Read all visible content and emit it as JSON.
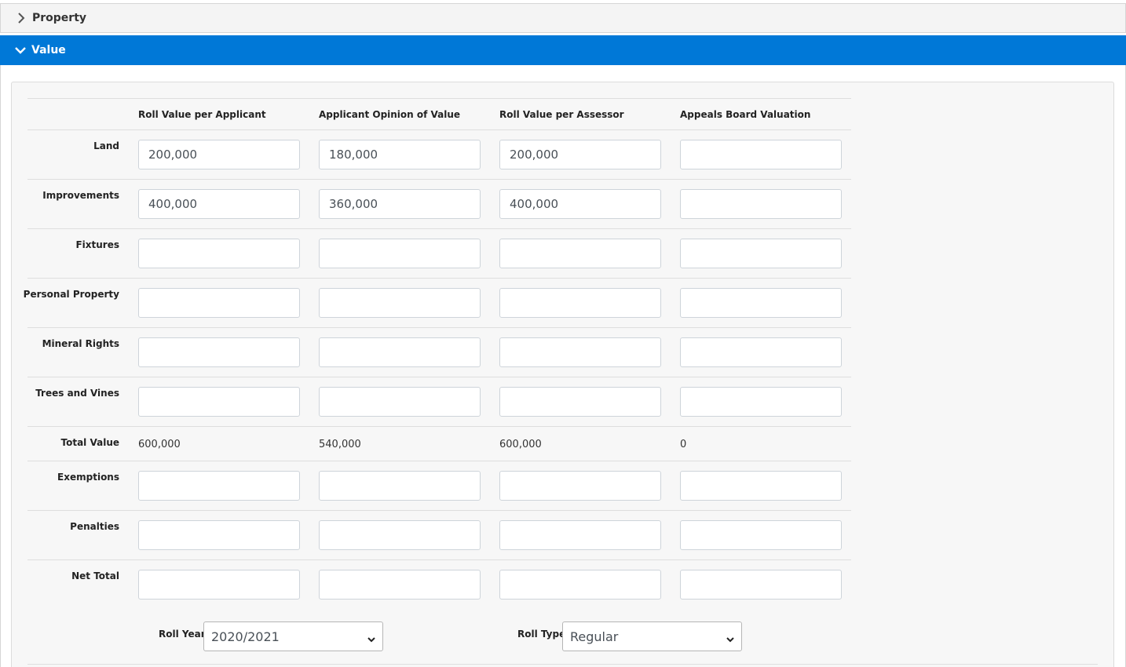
{
  "sections": {
    "property": {
      "title": "Property",
      "expanded": false
    },
    "value": {
      "title": "Value",
      "expanded": true
    }
  },
  "colors": {
    "accent": "#0078d7"
  },
  "table": {
    "columns": [
      "Roll Value per Applicant",
      "Applicant Opinion of Value",
      "Roll Value per Assessor",
      "Appeals Board Valuation"
    ],
    "rows": [
      {
        "label": "Land",
        "values": [
          "200,000",
          "180,000",
          "200,000",
          ""
        ]
      },
      {
        "label": "Improvements",
        "values": [
          "400,000",
          "360,000",
          "400,000",
          ""
        ]
      },
      {
        "label": "Fixtures",
        "values": [
          "",
          "",
          "",
          ""
        ]
      },
      {
        "label": "Personal Property",
        "values": [
          "",
          "",
          "",
          ""
        ]
      },
      {
        "label": "Mineral Rights",
        "values": [
          "",
          "",
          "",
          ""
        ]
      },
      {
        "label": "Trees and Vines",
        "values": [
          "",
          "",
          "",
          ""
        ]
      }
    ],
    "total": {
      "label": "Total Value",
      "values": [
        "600,000",
        "540,000",
        "600,000",
        "0"
      ]
    },
    "rows_after": [
      {
        "label": "Exemptions",
        "values": [
          "",
          "",
          "",
          ""
        ]
      },
      {
        "label": "Penalties",
        "values": [
          "",
          "",
          "",
          ""
        ]
      },
      {
        "label": "Net Total",
        "values": [
          "",
          "",
          "",
          ""
        ]
      }
    ]
  },
  "roll_year": {
    "label": "Roll Year",
    "value": "2020/2021"
  },
  "roll_type": {
    "label": "Roll Type",
    "value": "Regular"
  }
}
